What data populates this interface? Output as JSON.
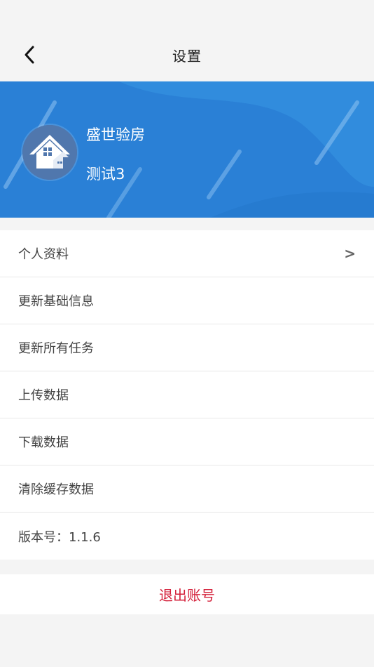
{
  "header": {
    "title": "设置",
    "back_icon": "chevron-left-icon"
  },
  "profile": {
    "company": "盛世验房",
    "user": "测试3",
    "avatar_icon": "house-icon",
    "banner_color": "#2a80d6"
  },
  "menu": {
    "items": [
      {
        "label": "个人资料",
        "chevron": ">"
      },
      {
        "label": "更新基础信息"
      },
      {
        "label": "更新所有任务"
      },
      {
        "label": "上传数据"
      },
      {
        "label": "下载数据"
      },
      {
        "label": "清除缓存数据"
      },
      {
        "label": "版本号：1.1.6"
      }
    ]
  },
  "logout": {
    "label": "退出账号",
    "color": "#d4213b"
  }
}
